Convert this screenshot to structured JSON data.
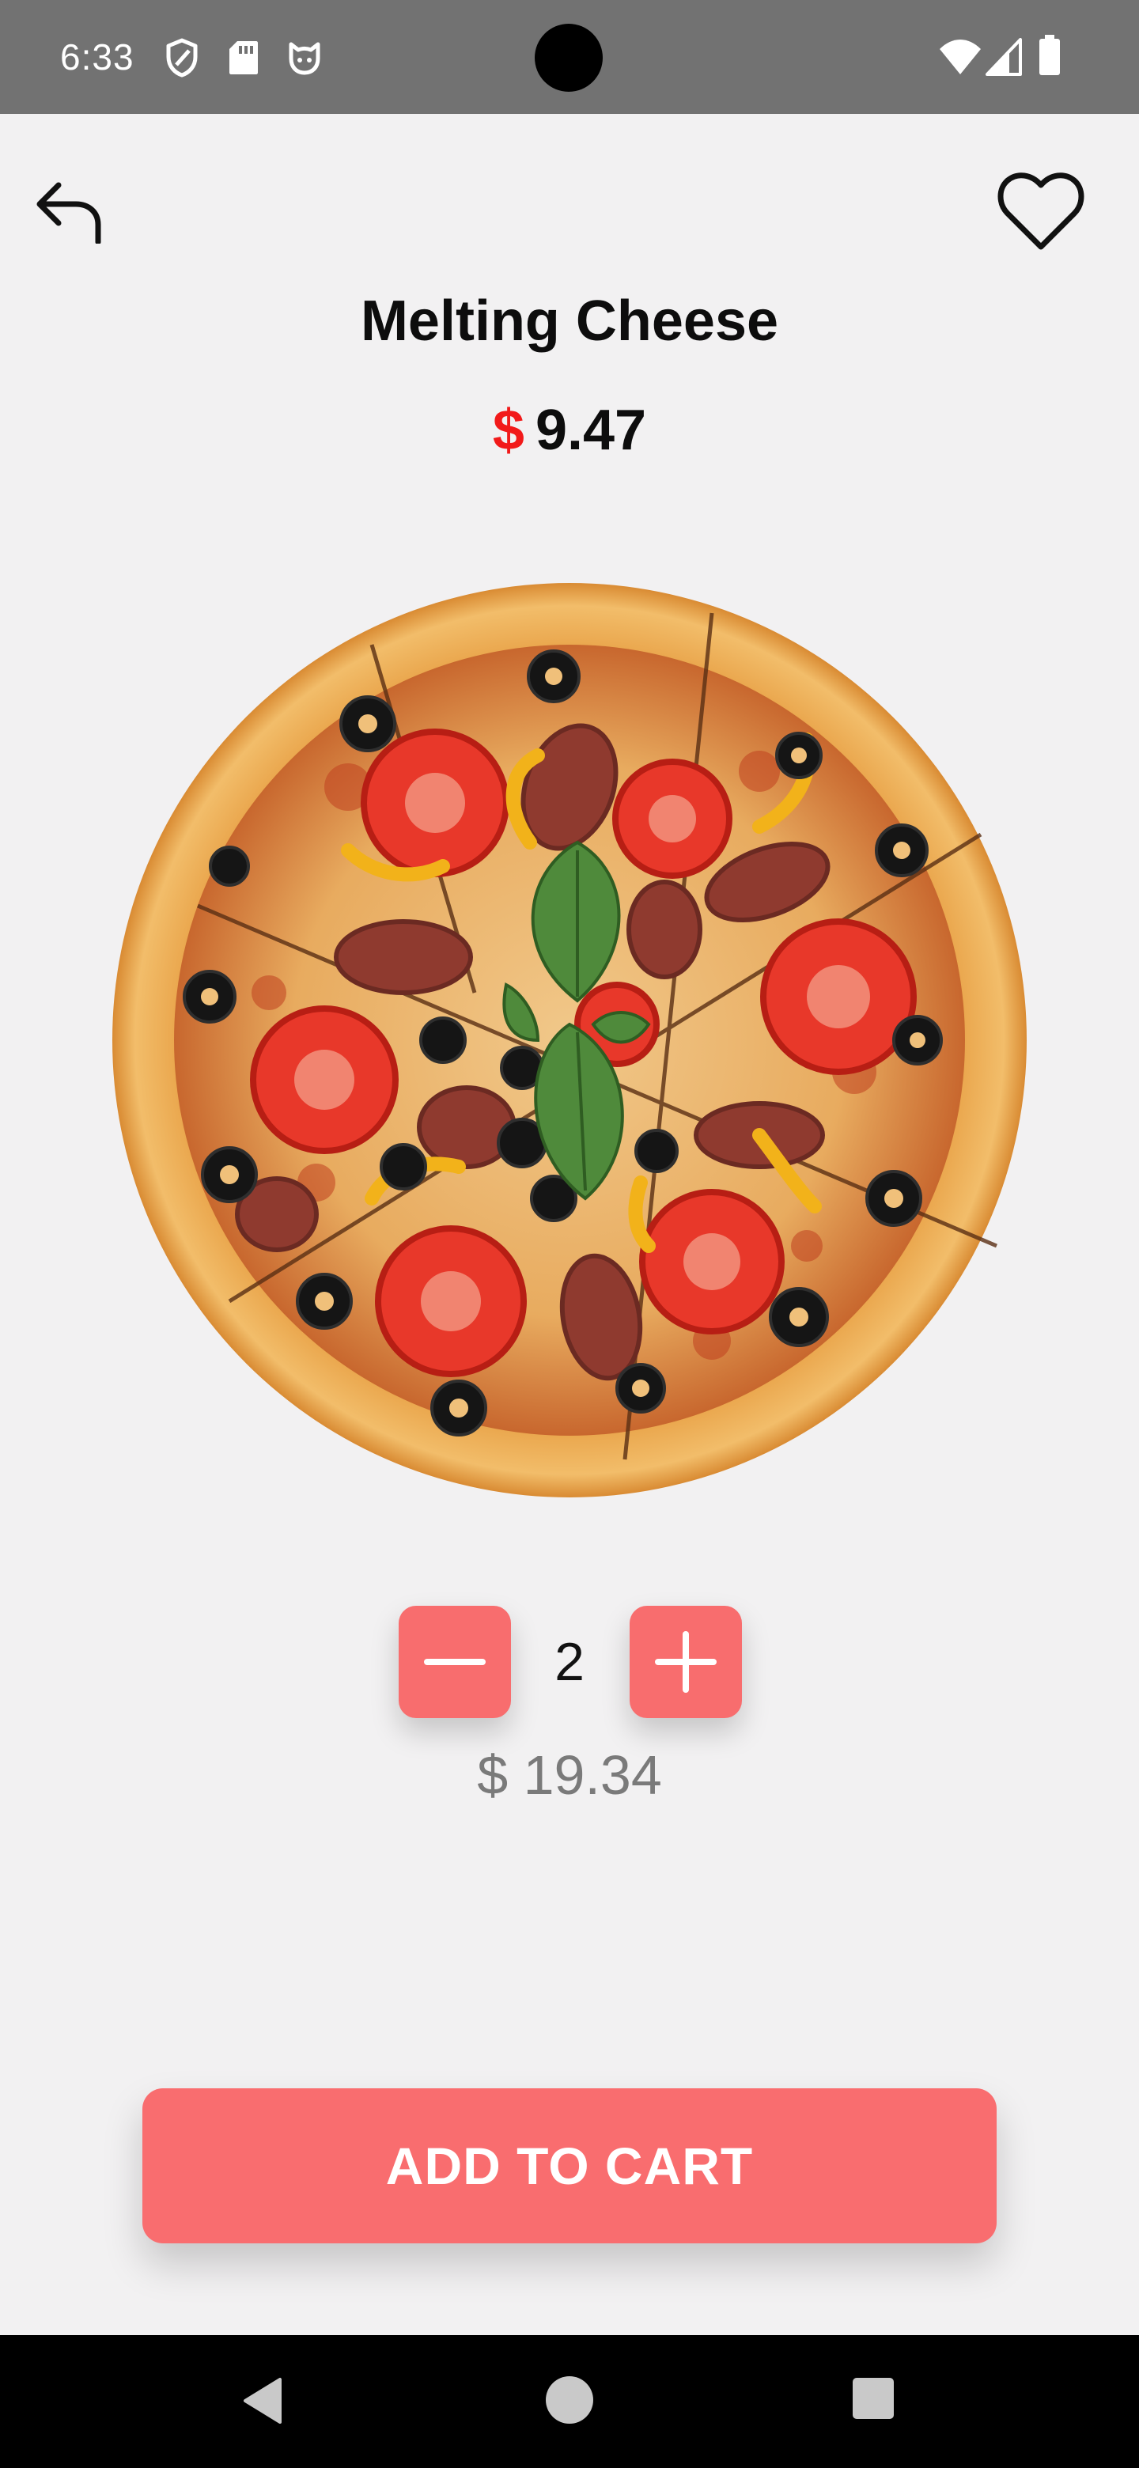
{
  "status_bar": {
    "time": "6:33",
    "left_icons": [
      "shield-icon",
      "sd-card-icon",
      "cat-face-icon"
    ],
    "right_icons": [
      "wifi-icon",
      "signal-icon",
      "battery-icon"
    ]
  },
  "top_bar": {
    "back_icon": "back-arrow-icon",
    "favorite_icon": "heart-outline-icon"
  },
  "product": {
    "name": "Melting Cheese",
    "currency_symbol": "$",
    "unit_price": "9.47",
    "image": "pizza-photo"
  },
  "quantity": {
    "decrement_icon": "minus-icon",
    "value": "2",
    "increment_icon": "plus-icon"
  },
  "total": {
    "text": "$ 19.34"
  },
  "cart_button": {
    "label": "ADD TO CART"
  },
  "nav_bar": {
    "back_icon": "nav-back-icon",
    "home_icon": "nav-home-icon",
    "recents_icon": "nav-recents-icon"
  },
  "colors": {
    "accent": "#f86d6e",
    "price_symbol": "#f21a1a",
    "background": "#f2f1f2",
    "status_bar": "#727272"
  }
}
